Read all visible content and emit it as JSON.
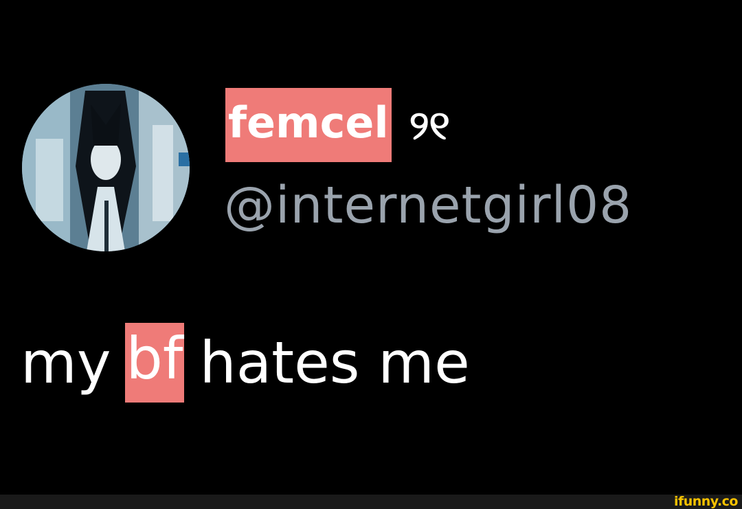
{
  "tweet": {
    "display_name": "femcel",
    "name_symbol": "୨୧",
    "handle": "@internetgirl08",
    "text_before": "my",
    "text_highlight": "bf",
    "text_after": "hates me",
    "highlight_color": "#ef7b78",
    "avatar_icon": "anime-girl-avatar"
  },
  "footer": {
    "watermark": "ifunny.co",
    "watermark_color": "#f7c200"
  }
}
